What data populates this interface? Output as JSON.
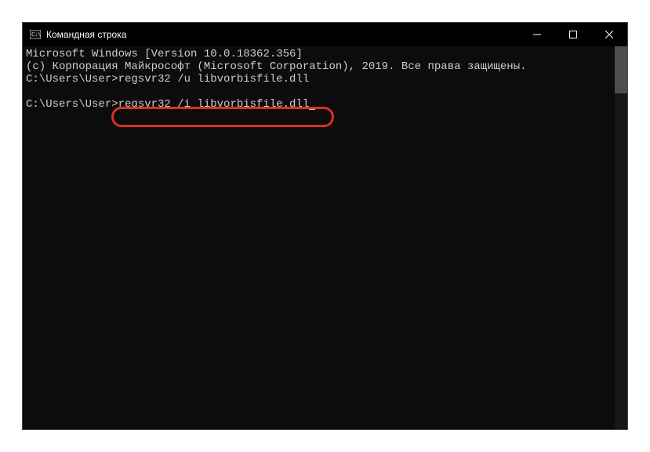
{
  "window": {
    "title": "Командная строка"
  },
  "terminal": {
    "line1": "Microsoft Windows [Version 10.0.18362.356]",
    "line2": "(c) Корпорация Майкрософт (Microsoft Corporation), 2019. Все права защищены.",
    "line3": "",
    "prompt1": "C:\\Users\\User>",
    "command1": "regsvr32 /u libvorbisfile.dll",
    "prompt2": "C:\\Users\\User>",
    "command2": "regsvr32 /i libvorbisfile.dll"
  }
}
